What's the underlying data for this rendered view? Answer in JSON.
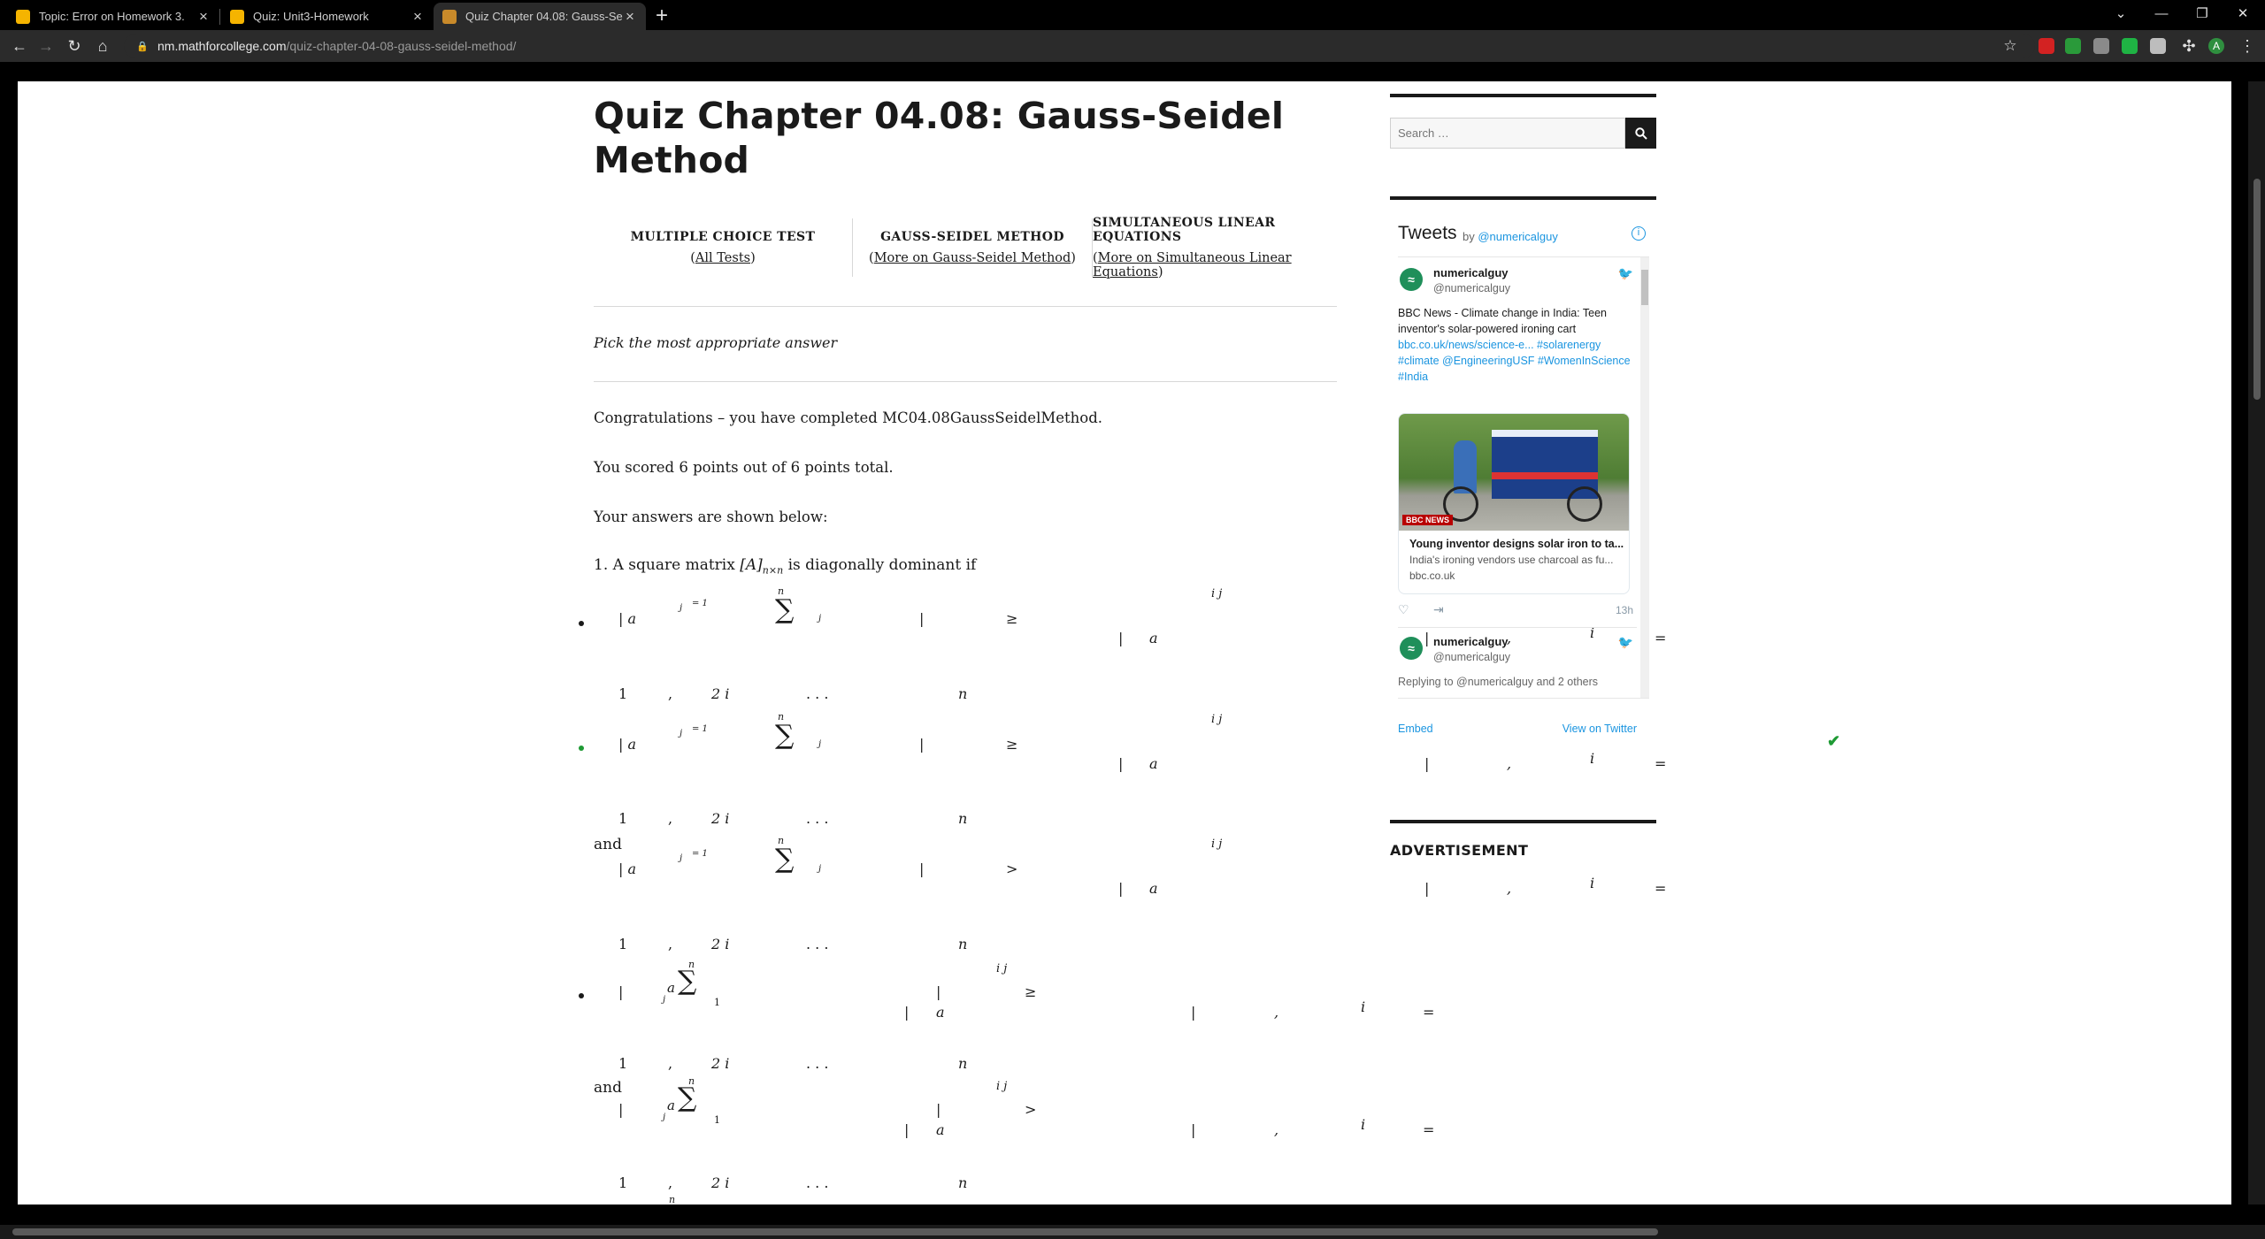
{
  "browser": {
    "tabs": [
      {
        "label": "Topic: Error on Homework 3.",
        "active": false,
        "favicon_color": "#f5b400"
      },
      {
        "label": "Quiz: Unit3-Homework",
        "active": false,
        "favicon_color": "#f5b400"
      },
      {
        "label": "Quiz Chapter 04.08: Gauss-Seidel",
        "active": true,
        "favicon_color": "#c98a2a"
      }
    ],
    "url_host": "nm.mathforcollege.com",
    "url_path": "/quiz-chapter-04-08-gauss-seidel-method/",
    "profile_initial": "A"
  },
  "page": {
    "title": "Quiz Chapter 04.08: Gauss-Seidel Method",
    "links": [
      {
        "head": "MULTIPLE CHOICE TEST",
        "link": "All Tests"
      },
      {
        "head": "GAUSS-SEIDEL METHOD",
        "link": "More on Gauss-Seidel Method"
      },
      {
        "head": "SIMULTANEOUS LINEAR EQUATIONS",
        "link": "More on Simultaneous Linear Equations"
      }
    ],
    "instruction": "Pick the most appropriate answer",
    "congrats": "Congratulations – you have completed MC04.08GaussSeidelMethod.",
    "score": "You scored 6 points out of 6 points total.",
    "answers_intro": "Your answers are shown below:",
    "question": {
      "prefix": "1. A square matrix ",
      "matrix": "[A]",
      "subscript": "n×n",
      "suffix": " is diagonally dominant if"
    },
    "and_label": "and",
    "checkmark": "✔",
    "math": {
      "abs_a": "| a",
      "sub_j": "j",
      "eq_1": "= 1",
      "sum": "∑",
      "n": "n",
      "bar": "|",
      "ge": "≥",
      "gt": ">",
      "a": "a",
      "ij": "i  j",
      "i": "i",
      "comma": ",",
      "equals": "=",
      "one": "1",
      "two": "2",
      "dots": ".   .   .",
      "two_i": "2  i"
    }
  },
  "sidebar": {
    "search_placeholder": "Search …",
    "tweets_title": "Tweets",
    "tweets_by": "by",
    "tweets_handle": "@numericalguy",
    "info_glyph": "i",
    "tweet1": {
      "name": "numericalguy",
      "handle": "@numericalguy",
      "text": "BBC News - Climate change in India: Teen inventor's solar-powered ironing cart",
      "links": "bbc.co.uk/news/science-e... #solarenergy #climate @EngineeringUSF #WomenInScience #India",
      "card_title": "Young inventor designs solar iron to ta...",
      "card_desc": "India's ironing vendors use charcoal as fu...",
      "card_url": "bbc.co.uk",
      "badge": "BBC NEWS",
      "time": "13h"
    },
    "tweet2": {
      "name": "numericalguy",
      "handle": "@numericalguy",
      "text": "Replying to @numericalguy and 2 others"
    },
    "embed": "Embed",
    "view_on_twitter": "View on Twitter",
    "advertisement": "ADVERTISEMENT"
  }
}
